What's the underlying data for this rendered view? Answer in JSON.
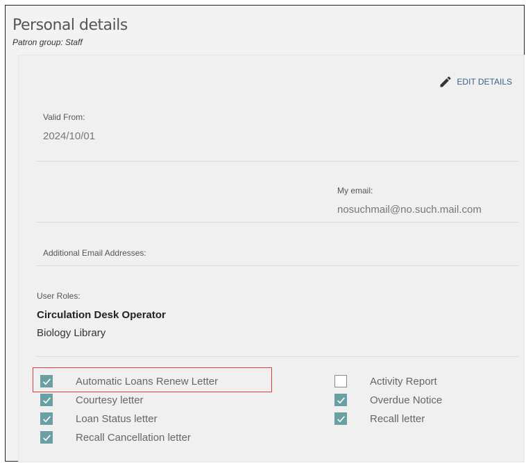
{
  "header": {
    "title": "Personal details",
    "patron_group": "Patron group: Staff"
  },
  "card": {
    "edit_details": "EDIT DETAILS",
    "valid_from_label": "Valid From:",
    "valid_from_value": "2024/10/01",
    "my_email_label": "My email:",
    "my_email_value": "nosuchmail@no.such.mail.com",
    "additional_emails_label": "Additional Email Addresses:",
    "user_roles_label": "User Roles:",
    "role_name": "Circulation Desk Operator",
    "role_library": "Biology Library"
  },
  "letters_left": [
    {
      "label": "Automatic Loans Renew Letter",
      "checked": true
    },
    {
      "label": "Courtesy letter",
      "checked": true
    },
    {
      "label": "Loan Status letter",
      "checked": true
    },
    {
      "label": "Recall Cancellation letter",
      "checked": true
    }
  ],
  "letters_right": [
    {
      "label": "Activity Report",
      "checked": false
    },
    {
      "label": "Overdue Notice",
      "checked": true
    },
    {
      "label": "Recall letter",
      "checked": true
    }
  ],
  "colors": {
    "checkbox_checked": "#6a9fa3",
    "highlight_border": "#e03b3b",
    "link": "#3a5f87"
  }
}
